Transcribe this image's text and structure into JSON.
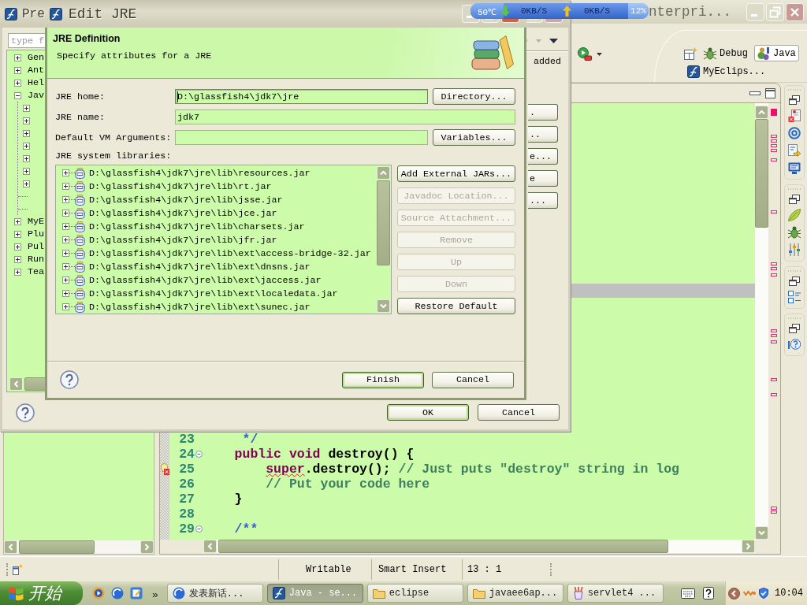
{
  "main_window": {
    "title": "nterpri...",
    "perspectives": [
      {
        "label": "Debug",
        "kind": "debug",
        "selected": false
      },
      {
        "label": "Java",
        "kind": "java",
        "selected": true
      },
      {
        "label": "MyEclips...",
        "kind": "myeclipse",
        "selected": false
      }
    ],
    "editor": {
      "lines": [
        {
          "number": "23",
          "fold": false,
          "error": false,
          "tokens": [
            {
              "kind": "doc",
              "text": "     */"
            }
          ]
        },
        {
          "number": "24",
          "fold": true,
          "error": false,
          "tokens": [
            {
              "kind": "keyword",
              "text": "    public void"
            },
            {
              "kind": "plain",
              "text": " destroy() {"
            }
          ]
        },
        {
          "number": "25",
          "fold": false,
          "error": true,
          "tokens": [
            {
              "kind": "error",
              "text": "        super"
            },
            {
              "kind": "plain",
              "text": ".destroy(); "
            },
            {
              "kind": "comment",
              "text": "// Just puts \"destroy\" string in log"
            }
          ]
        },
        {
          "number": "26",
          "fold": false,
          "error": false,
          "tokens": [
            {
              "kind": "comment",
              "text": "        // Put your code here"
            }
          ]
        },
        {
          "number": "27",
          "fold": false,
          "error": false,
          "tokens": [
            {
              "kind": "plain",
              "text": "    }"
            }
          ]
        },
        {
          "number": "28",
          "fold": false,
          "error": false
        },
        {
          "number": "29",
          "fold": true,
          "error": false,
          "tokens": [
            {
              "kind": "doc",
              "text": "    /**"
            }
          ]
        }
      ]
    },
    "status_bar": [
      "Writable",
      "Smart Insert",
      "13 : 1"
    ]
  },
  "preferences_dialog": {
    "title": "Pre",
    "filter": {
      "placeholder": "type f"
    },
    "tree": [
      {
        "label": "Gen",
        "expanded": false
      },
      {
        "label": "Ant",
        "expanded": false
      },
      {
        "label": "Hel",
        "expanded": false
      },
      {
        "label": "Jav",
        "expanded": true,
        "children": [
          {
            "expandable": true
          },
          {
            "expandable": true
          },
          {
            "expandable": true
          },
          {
            "expandable": true
          },
          {
            "expandable": true
          },
          {
            "expandable": true
          },
          {
            "expandable": true
          },
          {
            "expandable": false
          },
          {
            "expandable": false
          }
        ]
      },
      {
        "label": "MyE",
        "expanded": false
      },
      {
        "label": "Plu",
        "expanded": false
      },
      {
        "label": "Pul",
        "expanded": false
      },
      {
        "label": "Run",
        "expanded": false
      },
      {
        "label": "Tea",
        "expanded": false
      }
    ],
    "page_description": "added",
    "page_buttons": [
      ".",
      "..",
      "e...",
      "e",
      "..."
    ],
    "buttons": [
      {
        "label": "OK",
        "default": true
      },
      {
        "label": "Cancel",
        "default": false
      }
    ]
  },
  "edit_jre_dialog": {
    "title": "Edit JRE",
    "header": {
      "title": "JRE Definition",
      "description": "Specify attributes for a JRE"
    },
    "fields": [
      {
        "label": "JRE home:",
        "value": "D:\\glassfish4\\jdk7\\jre",
        "focused": true,
        "button": "Directory..."
      },
      {
        "label": "JRE name:",
        "value": "jdk7",
        "focused": false
      },
      {
        "label": "Default VM Arguments:",
        "focused": false,
        "button": "Variables..."
      }
    ],
    "libraries_label": "JRE system libraries:",
    "libraries": [
      {
        "path": "D:\\glassfish4\\jdk7\\jre\\lib\\resources.jar",
        "expanded": false
      },
      {
        "path": "D:\\glassfish4\\jdk7\\jre\\lib\\rt.jar",
        "expanded": false
      },
      {
        "path": "D:\\glassfish4\\jdk7\\jre\\lib\\jsse.jar",
        "expanded": false
      },
      {
        "path": "D:\\glassfish4\\jdk7\\jre\\lib\\jce.jar",
        "expanded": false
      },
      {
        "path": "D:\\glassfish4\\jdk7\\jre\\lib\\charsets.jar",
        "expanded": false
      },
      {
        "path": "D:\\glassfish4\\jdk7\\jre\\lib\\jfr.jar",
        "expanded": false
      },
      {
        "path": "D:\\glassfish4\\jdk7\\jre\\lib\\ext\\access-bridge-32.jar",
        "expanded": false
      },
      {
        "path": "D:\\glassfish4\\jdk7\\jre\\lib\\ext\\dnsns.jar",
        "expanded": false
      },
      {
        "path": "D:\\glassfish4\\jdk7\\jre\\lib\\ext\\jaccess.jar",
        "expanded": false
      },
      {
        "path": "D:\\glassfish4\\jdk7\\jre\\lib\\ext\\localedata.jar",
        "expanded": false
      },
      {
        "path": "D:\\glassfish4\\jdk7\\jre\\lib\\ext\\sunec.jar",
        "expanded": false
      }
    ],
    "library_buttons": [
      {
        "label": "Add External JARs...",
        "disabled": false
      },
      {
        "label": "Javadoc Location...",
        "disabled": true
      },
      {
        "label": "Source Attachment...",
        "disabled": true
      },
      {
        "label": "Remove",
        "disabled": true
      },
      {
        "label": "Up",
        "disabled": true
      },
      {
        "label": "Down",
        "disabled": true
      },
      {
        "label": "Restore Default",
        "disabled": false
      }
    ],
    "buttons": [
      {
        "label": "Finish",
        "default": true
      },
      {
        "label": "Cancel",
        "default": false
      }
    ]
  },
  "system_monitor": {
    "temperature": "50℃",
    "download": "0KB/S",
    "upload": "0KB/S",
    "cpu": "12%"
  },
  "taskbar": {
    "start": "开始",
    "more": "»",
    "tasks": [
      {
        "label": "发表新话...",
        "kind": "browser",
        "selected": false
      },
      {
        "label": "Java - se...",
        "kind": "eclipse",
        "selected": true
      },
      {
        "label": "eclipse",
        "kind": "folder",
        "selected": false
      },
      {
        "label": "javaee6ap...",
        "kind": "folder",
        "selected": false
      },
      {
        "label": "servlet4 ...",
        "kind": "app",
        "selected": false
      }
    ],
    "clock": "10:04"
  }
}
